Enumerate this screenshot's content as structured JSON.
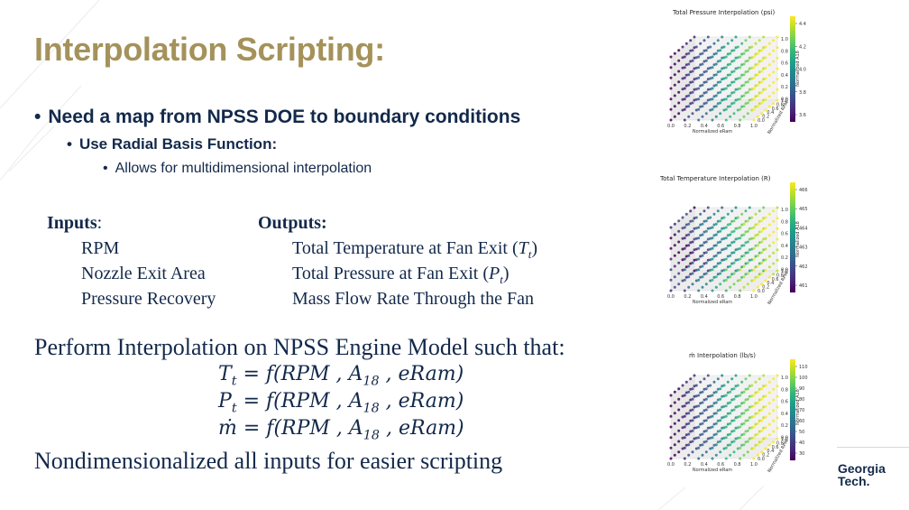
{
  "slide": {
    "title": "Interpolation Scripting:",
    "bullet_1": "Need a map from NPSS DOE to boundary conditions",
    "bullet_2": "Use Radial Basis Function:",
    "bullet_3": "Allows for multidimensional interpolation",
    "inputs_header": "Inputs",
    "inputs_colon": ":",
    "inputs": [
      "RPM",
      "Nozzle Exit Area",
      "Pressure Recovery"
    ],
    "outputs_header": "Outputs:",
    "outputs": [
      {
        "text": "Total Temperature at Fan Exit (",
        "var": "T",
        "sub": "t",
        "close": ")"
      },
      {
        "text": "Total Pressure at Fan Exit (",
        "var": "P",
        "sub": "t",
        "close": ")"
      },
      {
        "text": "Mass Flow Rate Through the Fan",
        "var": "",
        "sub": "",
        "close": ""
      }
    ],
    "perform_line": "Perform Interpolation on NPSS Engine Model such that:",
    "equations": [
      {
        "lhs": "T",
        "lhs_sub": "t",
        "rhs_a": "= f(RPM , A",
        "rhs_sub": "18",
        "rhs_b": " , eRam)"
      },
      {
        "lhs": "P",
        "lhs_sub": "t",
        "rhs_a": "= f(RPM , A",
        "rhs_sub": "18",
        "rhs_b": " , eRam)"
      },
      {
        "lhs": "ṁ",
        "lhs_sub": "",
        "rhs_a": "= f(RPM , A",
        "rhs_sub": "18",
        "rhs_b": " , eRam)"
      }
    ],
    "nondim_line": "Nondimensionalized all inputs for easier scripting",
    "logo_line1": "Georgia",
    "logo_line2": "Tech."
  },
  "plots": [
    {
      "title": "Total Pressure Interpolation (psi)",
      "xlabel": "Normalized eRam",
      "ylabel": "Normalized RPM",
      "zlabel": "Normalized A18",
      "x_ticks": [
        "0.0",
        "0.2",
        "0.4",
        "0.6",
        "0.8",
        "1.0"
      ],
      "z_ticks": [
        "1.0",
        "0.8",
        "0.6",
        "0.4",
        "0.2",
        "0.0"
      ],
      "y_ticks": [
        "1.0",
        "0.8",
        "0.6",
        "0.4",
        "0.2",
        "0.0"
      ],
      "colorbar_ticks": [
        "4.4",
        "4.2",
        "4.0",
        "3.8",
        "3.6"
      ],
      "colormap": "viridis"
    },
    {
      "title": "Total Temperature Interpolation (R)",
      "xlabel": "Normalized eRam",
      "ylabel": "Normalized RPM",
      "zlabel": "Normalized A18",
      "x_ticks": [
        "0.0",
        "0.2",
        "0.4",
        "0.6",
        "0.8",
        "1.0"
      ],
      "z_ticks": [
        "1.0",
        "0.8",
        "0.6",
        "0.4",
        "0.2",
        "0.0"
      ],
      "y_ticks": [
        "1.0",
        "0.8",
        "0.6",
        "0.4",
        "0.2",
        "0.0"
      ],
      "colorbar_ticks": [
        "466",
        "465",
        "464",
        "463",
        "462",
        "461"
      ],
      "colormap": "viridis"
    },
    {
      "title": "ṁ Interpolation (lb/s)",
      "xlabel": "Normalized eRam",
      "ylabel": "Normalized RPM",
      "zlabel": "Normalized A18",
      "x_ticks": [
        "0.0",
        "0.2",
        "0.4",
        "0.6",
        "0.8",
        "1.0"
      ],
      "z_ticks": [
        "1.0",
        "0.8",
        "0.6",
        "0.4",
        "0.2",
        "0.0"
      ],
      "y_ticks": [
        "1.0",
        "0.8",
        "0.6",
        "0.4",
        "0.2",
        "0.0"
      ],
      "colorbar_ticks": [
        "110",
        "100",
        "90",
        "80",
        "70",
        "60",
        "50",
        "40",
        "30"
      ],
      "colormap": "viridis"
    }
  ],
  "colors": {
    "title_gold": "#a4925a",
    "navy": "#13294b"
  }
}
